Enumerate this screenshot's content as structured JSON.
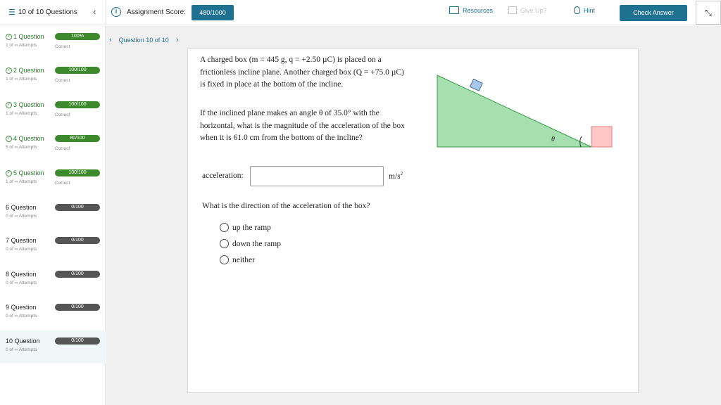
{
  "topbar": {
    "question_count": "10 of 10 Questions",
    "score_label": "Assignment Score:",
    "score_value": "480/1000",
    "resources": "Resources",
    "give_up": "Give Up?",
    "hint": "Hint",
    "check_answer": "Check Answer"
  },
  "sidebar": {
    "items": [
      {
        "title": "1 Question",
        "attempts": "1 of ∞ Attempts",
        "badge": "100%",
        "status": "Correct",
        "done": true
      },
      {
        "title": "2 Question",
        "attempts": "1 of ∞ Attempts",
        "badge": "100/100",
        "status": "Correct",
        "done": true
      },
      {
        "title": "3 Question",
        "attempts": "1 of ∞ Attempts",
        "badge": "100/100",
        "status": "Correct",
        "done": true
      },
      {
        "title": "4 Question",
        "attempts": "5 of ∞ Attempts",
        "badge": "80/100",
        "status": "Correct",
        "done": true
      },
      {
        "title": "5 Question",
        "attempts": "1 of ∞ Attempts",
        "badge": "100/100",
        "status": "Correct",
        "done": true
      },
      {
        "title": "6 Question",
        "attempts": "0 of ∞ Attempts",
        "badge": "0/100",
        "status": "",
        "done": false
      },
      {
        "title": "7 Question",
        "attempts": "0 of ∞ Attempts",
        "badge": "0/100",
        "status": "",
        "done": false
      },
      {
        "title": "8 Question",
        "attempts": "0 of ∞ Attempts",
        "badge": "0/100",
        "status": "",
        "done": false
      },
      {
        "title": "9 Question",
        "attempts": "0 of ∞ Attempts",
        "badge": "0/100",
        "status": "",
        "done": false
      },
      {
        "title": "10 Question",
        "attempts": "0 of ∞ Attempts",
        "badge": "0/100",
        "status": "",
        "done": false
      }
    ]
  },
  "question": {
    "nav_label": "Question 10 of 10",
    "para1": "A charged box (m = 445 g, q = +2.50 µC) is placed on a frictionless incline plane. Another charged box (Q = +75.0 µC) is fixed in place at the bottom of the incline.",
    "para2": "If the inclined plane makes an angle θ of 35.0° with the horizontal, what is the magnitude of the acceleration of the box when it is 61.0 cm from the bottom of the incline?",
    "accel_label": "acceleration:",
    "accel_value": "",
    "accel_unit": "m/s",
    "accel_unit_exp": "2",
    "direction_question": "What is the direction of the acceleration of the box?",
    "options": [
      "up the ramp",
      "down the ramp",
      "neither"
    ],
    "diagram_angle_label": "θ"
  },
  "colors": {
    "accent": "#1f7191",
    "incline_fill": "#a6e0b0",
    "incline_stroke": "#3a9a4a",
    "box_top": "#a8c8ea",
    "box_fixed": "#ffc8c8"
  }
}
